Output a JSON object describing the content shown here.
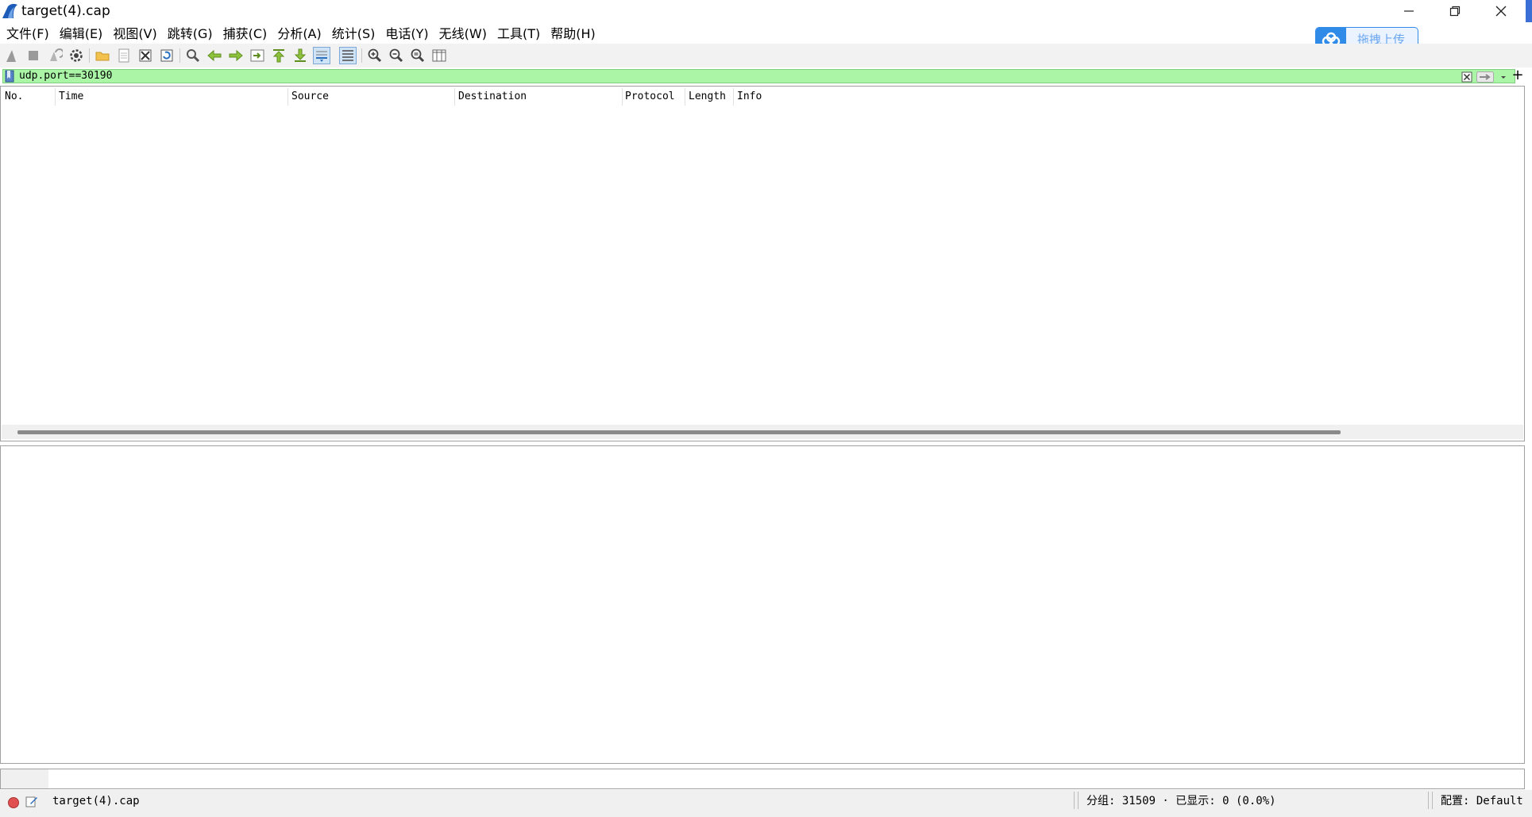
{
  "window": {
    "title": "target(4).cap",
    "minimize_icon": "minimize-icon",
    "restore_icon": "restore-icon",
    "close_icon": "close-icon"
  },
  "menu": {
    "items": [
      "文件(F)",
      "编辑(E)",
      "视图(V)",
      "跳转(G)",
      "捕获(C)",
      "分析(A)",
      "统计(S)",
      "电话(Y)",
      "无线(W)",
      "工具(T)",
      "帮助(H)"
    ]
  },
  "upload_widget": {
    "label": "拖拽上传",
    "icon": "cloud-icon",
    "accent_color": "#2f8ae8"
  },
  "filter": {
    "value": "udp.port==30190",
    "background_color": "#aaf6a6",
    "add_label": "+"
  },
  "packet_list": {
    "columns": [
      "No.",
      "Time",
      "Source",
      "Destination",
      "Protocol",
      "Length",
      "Info"
    ],
    "rows": []
  },
  "statusbar": {
    "file": "target(4).cap",
    "packets": "分组: 31509 · 已显示: 0 (0.0%)",
    "profile": "配置: Default"
  }
}
